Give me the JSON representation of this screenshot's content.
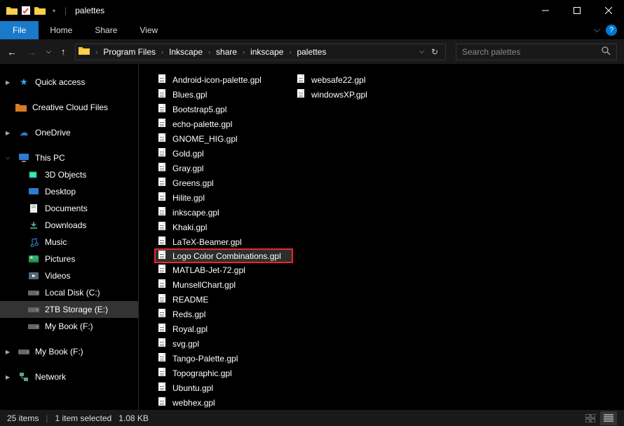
{
  "titlebar": {
    "title": "palettes"
  },
  "menu": {
    "file": "File",
    "home": "Home",
    "share": "Share",
    "view": "View"
  },
  "address": {
    "segments": [
      "Program Files",
      "Inkscape",
      "share",
      "inkscape",
      "palettes"
    ]
  },
  "search": {
    "placeholder": "Search palettes"
  },
  "sidebar": {
    "quick_access": "Quick access",
    "creative_cloud": "Creative Cloud Files",
    "onedrive": "OneDrive",
    "this_pc": "This PC",
    "pc_children": [
      "3D Objects",
      "Desktop",
      "Documents",
      "Downloads",
      "Music",
      "Pictures",
      "Videos",
      "Local Disk (C:)",
      "2TB Storage (E:)",
      "My Book (F:)"
    ],
    "my_book": "My Book (F:)",
    "network": "Network"
  },
  "files": {
    "col1": [
      "Android-icon-palette.gpl",
      "Blues.gpl",
      "Bootstrap5.gpl",
      "echo-palette.gpl",
      "GNOME_HIG.gpl",
      "Gold.gpl",
      "Gray.gpl",
      "Greens.gpl",
      "Hilite.gpl",
      "inkscape.gpl",
      "Khaki.gpl",
      "LaTeX-Beamer.gpl",
      "Logo Color Combinations.gpl",
      "MATLAB-Jet-72.gpl",
      "MunsellChart.gpl",
      "README",
      "Reds.gpl",
      "Royal.gpl",
      "svg.gpl",
      "Tango-Palette.gpl",
      "Topographic.gpl",
      "Ubuntu.gpl",
      "webhex.gpl"
    ],
    "col2": [
      "websafe22.gpl",
      "windowsXP.gpl"
    ],
    "highlighted_index": 12
  },
  "status": {
    "items": "25 items",
    "selected": "1 item selected",
    "size": "1.08 KB"
  }
}
